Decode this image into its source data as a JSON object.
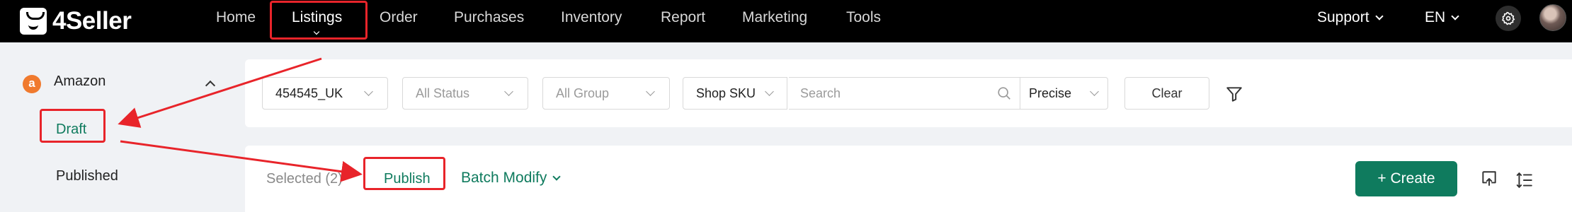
{
  "app": {
    "name": "4Seller"
  },
  "nav": {
    "items": [
      {
        "label": "Home",
        "active": false
      },
      {
        "label": "Listings",
        "active": true
      },
      {
        "label": "Order",
        "active": false
      },
      {
        "label": "Purchases",
        "active": false
      },
      {
        "label": "Inventory",
        "active": false
      },
      {
        "label": "Report",
        "active": false
      },
      {
        "label": "Marketing",
        "active": false
      },
      {
        "label": "Tools",
        "active": false
      }
    ],
    "support_label": "Support",
    "language_label": "EN"
  },
  "sidebar": {
    "section_title": "Amazon",
    "section_icon": "amazon-icon",
    "items": [
      {
        "label": "Draft",
        "active": true
      },
      {
        "label": "Published",
        "active": false
      }
    ]
  },
  "filters": {
    "store": "454545_UK",
    "status_placeholder": "All Status",
    "group_placeholder": "All Group",
    "field_select": "Shop SKU",
    "search_placeholder": "Search",
    "match_mode": "Precise",
    "clear_label": "Clear"
  },
  "actions": {
    "selected_text": "Selected (2)",
    "publish_label": "Publish",
    "batch_modify_label": "Batch Modify",
    "create_label": "+ Create"
  },
  "colors": {
    "accent": "#0f7b5e",
    "annotation": "#e8242a",
    "topbar": "#000000"
  }
}
